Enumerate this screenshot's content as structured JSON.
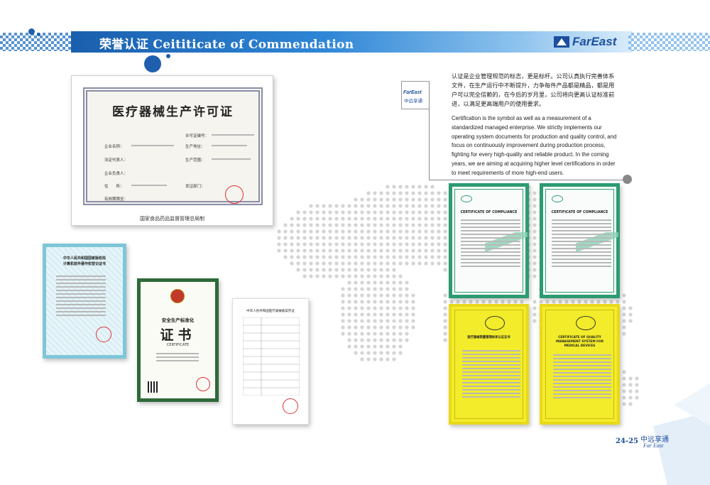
{
  "header": {
    "title": "荣誉认证 Ceititicate of Commendation",
    "brand": "FarEast"
  },
  "description": {
    "logo_en": "FarEast",
    "logo_cn": "中远享通",
    "cn": "认证是企业管理规范的标志，更是标杆。公司认真执行完善体系文件，在生产运行中不断提升，力争每件产品都是精品，都是用户可以完全信赖的，在今后的岁月里，公司将向更高认证标准前进，以满足更高端用户的使用要求。",
    "en": "Certification is the symbol as well as a measurement of a standardized managed enterprise. We strictly implements our operating system documents for production and quality control, and focus on continuously improvement during production process, fighting for every high-quality and reliable product. In the coming years, we are aiming at acquiring higher level certifications in order to meet requirements of more high-end users."
  },
  "certificates": {
    "medical_license": {
      "title": "医疗器械生产许可证",
      "license_no_label": "许可证编号：",
      "company_label": "企业名称：",
      "address_label": "生产地址：",
      "legal_rep_label": "法定代表人：",
      "scope_label": "生产范围：",
      "owner_label": "企业负责人：",
      "residence_label": "住　　所：",
      "issuer_label": "发证部门：",
      "validity_label": "有效期限至：",
      "footer": "国家食品药品监督管理总局制"
    },
    "software": {
      "title_line1": "中华人民共和国国家版权局",
      "title_line2": "计算机软件著作权登记证书"
    },
    "safety": {
      "header": "安全生产标准化",
      "title": "证书",
      "subtitle": "CERTIFICATE"
    },
    "form": {
      "title": "中华人民共和国医疗器械备案凭证"
    },
    "compliance": {
      "title": "CERTIFICATE OF COMPLIANCE"
    },
    "iso": {
      "title_cn": "医疗器械质量管理体系认证证书",
      "title_en": "CERTIFICATE OF QUALITY MANAGEMENT SYSTEM FOR MEDICAL DEVICES"
    }
  },
  "footer": {
    "page": "24-25",
    "logo_cn": "中远享通",
    "logo_en": "Far East"
  },
  "colors": {
    "brand_blue": "#1d4f9c",
    "header_blue": "#2f86d6",
    "ce_green": "#2d9b72",
    "iso_yellow": "#f3ec2a",
    "safety_green": "#2f6a3a"
  }
}
